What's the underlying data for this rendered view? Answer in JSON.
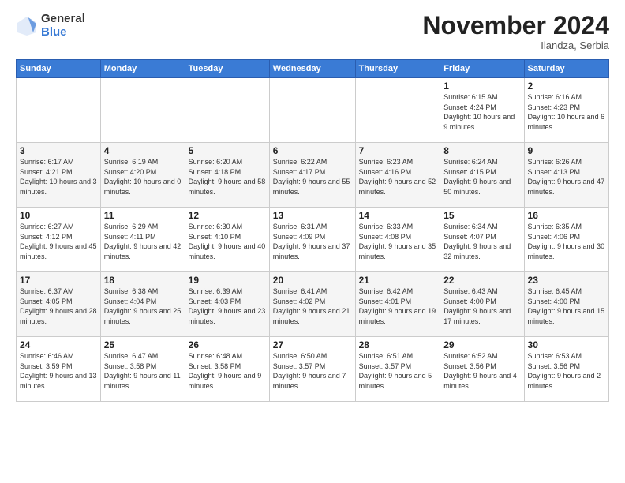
{
  "header": {
    "logo_general": "General",
    "logo_blue": "Blue",
    "month_title": "November 2024",
    "subtitle": "Ilandza, Serbia"
  },
  "weekdays": [
    "Sunday",
    "Monday",
    "Tuesday",
    "Wednesday",
    "Thursday",
    "Friday",
    "Saturday"
  ],
  "weeks": [
    [
      {
        "day": "",
        "info": ""
      },
      {
        "day": "",
        "info": ""
      },
      {
        "day": "",
        "info": ""
      },
      {
        "day": "",
        "info": ""
      },
      {
        "day": "",
        "info": ""
      },
      {
        "day": "1",
        "info": "Sunrise: 6:15 AM\nSunset: 4:24 PM\nDaylight: 10 hours and 9 minutes."
      },
      {
        "day": "2",
        "info": "Sunrise: 6:16 AM\nSunset: 4:23 PM\nDaylight: 10 hours and 6 minutes."
      }
    ],
    [
      {
        "day": "3",
        "info": "Sunrise: 6:17 AM\nSunset: 4:21 PM\nDaylight: 10 hours and 3 minutes."
      },
      {
        "day": "4",
        "info": "Sunrise: 6:19 AM\nSunset: 4:20 PM\nDaylight: 10 hours and 0 minutes."
      },
      {
        "day": "5",
        "info": "Sunrise: 6:20 AM\nSunset: 4:18 PM\nDaylight: 9 hours and 58 minutes."
      },
      {
        "day": "6",
        "info": "Sunrise: 6:22 AM\nSunset: 4:17 PM\nDaylight: 9 hours and 55 minutes."
      },
      {
        "day": "7",
        "info": "Sunrise: 6:23 AM\nSunset: 4:16 PM\nDaylight: 9 hours and 52 minutes."
      },
      {
        "day": "8",
        "info": "Sunrise: 6:24 AM\nSunset: 4:15 PM\nDaylight: 9 hours and 50 minutes."
      },
      {
        "day": "9",
        "info": "Sunrise: 6:26 AM\nSunset: 4:13 PM\nDaylight: 9 hours and 47 minutes."
      }
    ],
    [
      {
        "day": "10",
        "info": "Sunrise: 6:27 AM\nSunset: 4:12 PM\nDaylight: 9 hours and 45 minutes."
      },
      {
        "day": "11",
        "info": "Sunrise: 6:29 AM\nSunset: 4:11 PM\nDaylight: 9 hours and 42 minutes."
      },
      {
        "day": "12",
        "info": "Sunrise: 6:30 AM\nSunset: 4:10 PM\nDaylight: 9 hours and 40 minutes."
      },
      {
        "day": "13",
        "info": "Sunrise: 6:31 AM\nSunset: 4:09 PM\nDaylight: 9 hours and 37 minutes."
      },
      {
        "day": "14",
        "info": "Sunrise: 6:33 AM\nSunset: 4:08 PM\nDaylight: 9 hours and 35 minutes."
      },
      {
        "day": "15",
        "info": "Sunrise: 6:34 AM\nSunset: 4:07 PM\nDaylight: 9 hours and 32 minutes."
      },
      {
        "day": "16",
        "info": "Sunrise: 6:35 AM\nSunset: 4:06 PM\nDaylight: 9 hours and 30 minutes."
      }
    ],
    [
      {
        "day": "17",
        "info": "Sunrise: 6:37 AM\nSunset: 4:05 PM\nDaylight: 9 hours and 28 minutes."
      },
      {
        "day": "18",
        "info": "Sunrise: 6:38 AM\nSunset: 4:04 PM\nDaylight: 9 hours and 25 minutes."
      },
      {
        "day": "19",
        "info": "Sunrise: 6:39 AM\nSunset: 4:03 PM\nDaylight: 9 hours and 23 minutes."
      },
      {
        "day": "20",
        "info": "Sunrise: 6:41 AM\nSunset: 4:02 PM\nDaylight: 9 hours and 21 minutes."
      },
      {
        "day": "21",
        "info": "Sunrise: 6:42 AM\nSunset: 4:01 PM\nDaylight: 9 hours and 19 minutes."
      },
      {
        "day": "22",
        "info": "Sunrise: 6:43 AM\nSunset: 4:00 PM\nDaylight: 9 hours and 17 minutes."
      },
      {
        "day": "23",
        "info": "Sunrise: 6:45 AM\nSunset: 4:00 PM\nDaylight: 9 hours and 15 minutes."
      }
    ],
    [
      {
        "day": "24",
        "info": "Sunrise: 6:46 AM\nSunset: 3:59 PM\nDaylight: 9 hours and 13 minutes."
      },
      {
        "day": "25",
        "info": "Sunrise: 6:47 AM\nSunset: 3:58 PM\nDaylight: 9 hours and 11 minutes."
      },
      {
        "day": "26",
        "info": "Sunrise: 6:48 AM\nSunset: 3:58 PM\nDaylight: 9 hours and 9 minutes."
      },
      {
        "day": "27",
        "info": "Sunrise: 6:50 AM\nSunset: 3:57 PM\nDaylight: 9 hours and 7 minutes."
      },
      {
        "day": "28",
        "info": "Sunrise: 6:51 AM\nSunset: 3:57 PM\nDaylight: 9 hours and 5 minutes."
      },
      {
        "day": "29",
        "info": "Sunrise: 6:52 AM\nSunset: 3:56 PM\nDaylight: 9 hours and 4 minutes."
      },
      {
        "day": "30",
        "info": "Sunrise: 6:53 AM\nSunset: 3:56 PM\nDaylight: 9 hours and 2 minutes."
      }
    ]
  ]
}
